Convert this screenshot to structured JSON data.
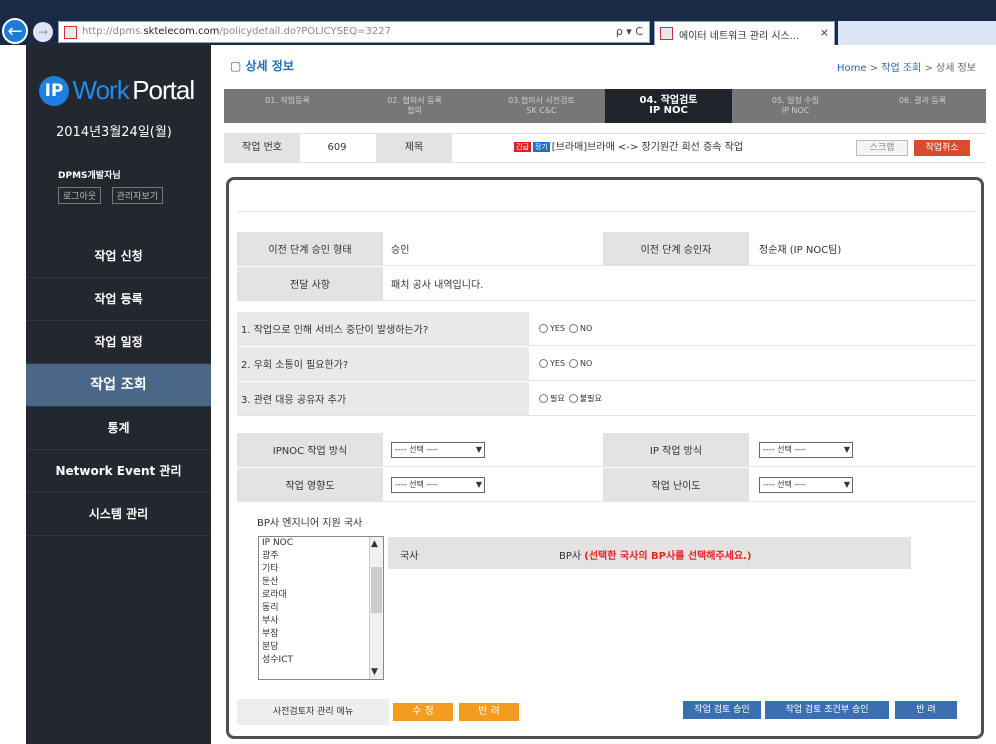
{
  "browser": {
    "url_prefix": "http://dpms.",
    "url_domain": "sktelecom.com",
    "url_suffix": "/policydetail.do?POLICYSEQ=3227",
    "address_tools": "ρ ▾ C",
    "tab_title": "에이터 네트워크 관리 시스...",
    "tab_close": "×"
  },
  "sidebar": {
    "logo_ip": "IP",
    "logo_work": "Work",
    "logo_portal": "Portal",
    "date": "2014년3월24일(월)",
    "user": "DPMS개발자님",
    "logout": "로그아웃",
    "admin": "관리자보기",
    "menu": [
      {
        "label": "작업 신청",
        "active": false
      },
      {
        "label": "작업 등록",
        "active": false
      },
      {
        "label": "작업 일정",
        "active": false
      },
      {
        "label": "작업 조회",
        "active": true
      },
      {
        "label": "통계",
        "active": false
      },
      {
        "label": "Network Event 관리",
        "active": false
      },
      {
        "label": "시스템 관리",
        "active": false
      }
    ]
  },
  "header": {
    "title": "상세 정보",
    "breadcrumb_home": "Home",
    "breadcrumb_sep1": " > ",
    "breadcrumb_mid": "작업 조회",
    "breadcrumb_sep2": " > ",
    "breadcrumb_cur": "상세 정보"
  },
  "steps": [
    {
      "line1": "01. 작업등록",
      "line2": ""
    },
    {
      "line1": "02. 협의서 등록",
      "line2": "협의"
    },
    {
      "line1": "03.협의서 사전검토",
      "line2": "SK C&C"
    },
    {
      "line1": "04. 작업검토",
      "line2": "IP NOC"
    },
    {
      "line1": "05. 일정 수립",
      "line2": "IP NOC"
    },
    {
      "line1": "06. 결과 등록",
      "line2": ""
    }
  ],
  "info": {
    "job_no_label": "작업 번호",
    "job_no": "609",
    "subject_label": "제목",
    "tag1": "긴급",
    "tag2": "정기",
    "subject": "[브라매]브라매 <-> 장기원간 회선 증속 작업",
    "cancel_button": "스크랩",
    "red_button": "작업취소"
  },
  "review": {
    "prev_state_label": "이전 단계 승인 형태",
    "prev_state": "승인",
    "prev_approver_label": "이전 단계 승인자",
    "prev_approver": "정순재 (IP NOC팀)",
    "notes_label": "전달 사항",
    "notes": "패치 공사 내역입니다.",
    "q1": "1. 작업으로 인해 서비스 중단이 발생하는가?",
    "q2": "2. 우회 소통이 필요한가?",
    "q3": "3. 관련 대응 공유자 추가",
    "yes": "YES",
    "no": "NO",
    "need": "필요",
    "no_need": "불필요",
    "ipnoc_method_label": "IPNOC 작업 방식",
    "ip_method_label": "IP 작업 방식",
    "impact_label": "작업 영향도",
    "difficulty_label": "작업 난이도",
    "select_placeholder": "---- 선택 ----"
  },
  "bp": {
    "section_label": "BP사 엔지니어 지원 국사",
    "stations": [
      "IP NOC",
      "광주",
      "기타",
      "둔산",
      "로라대",
      "동리",
      "부사",
      "부잠",
      "분당",
      "성수ICT"
    ],
    "col_station": "국사",
    "col_bp": "BP사",
    "col_bp_hint": "(선택한 국사의 BP사를 선택해주세요.)"
  },
  "actions": {
    "manager_menu": "사전검토자 관리 메뉴",
    "modify": "수 정",
    "return": "반 려",
    "approve": "작업 검토 승인",
    "cond_approve": "작업 검토 조건부 승인",
    "reject": "반 려"
  },
  "colors": {
    "sidebar_bg": "#23272e",
    "active_menu": "#4b6788",
    "accent_blue": "#1f8bf0",
    "red": "#d84b2c",
    "orange": "#f39c1f",
    "button_blue": "#3a6fb1"
  }
}
